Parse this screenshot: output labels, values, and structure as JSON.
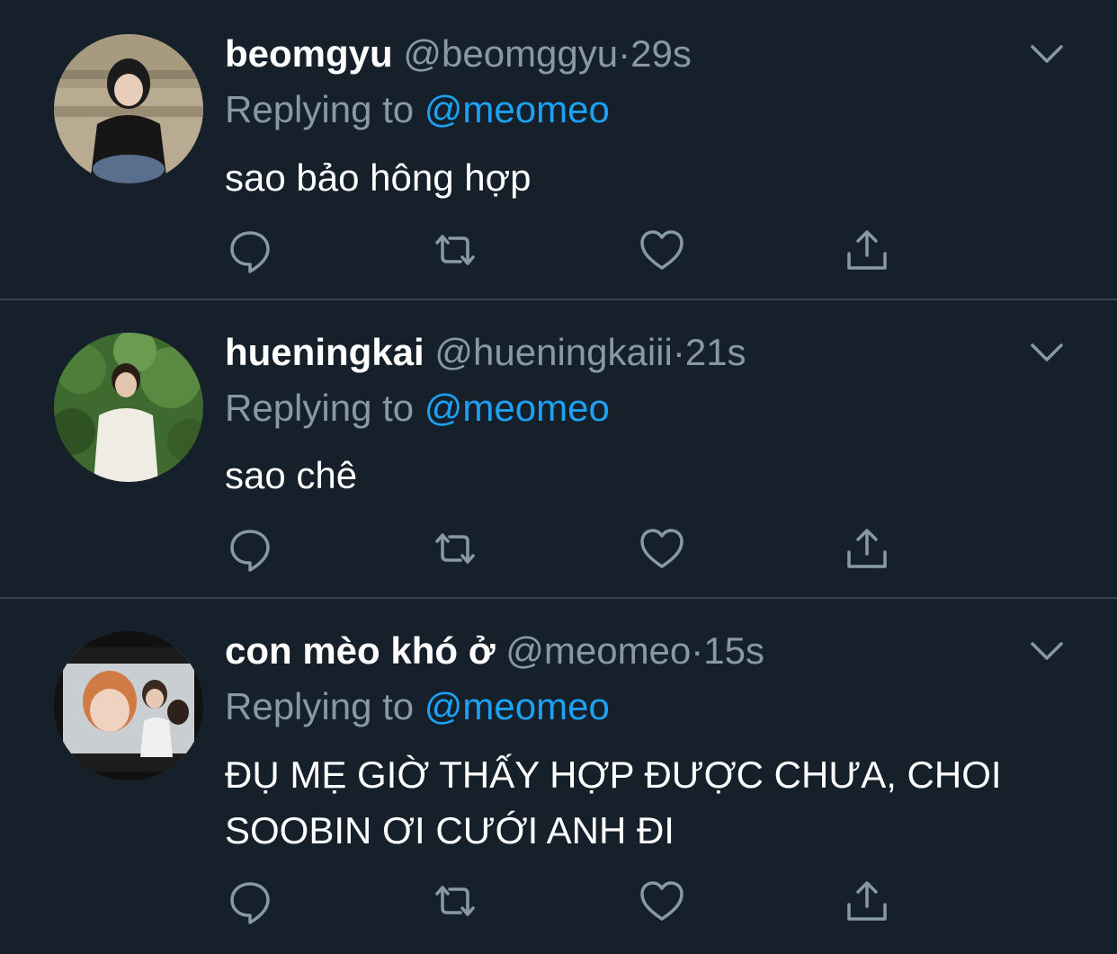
{
  "colors": {
    "background": "#15202b",
    "divider": "#38444d",
    "muted": "#8899a6",
    "mention": "#1da1f2",
    "text": "#ffffff"
  },
  "tweets": [
    {
      "name": "beomgyu",
      "handle": "@beomggyu",
      "dot": "·",
      "time": "29s",
      "replying_label": "Replying to",
      "replying_to": "@meomeo",
      "text": "sao bảo hông hợp",
      "avatar_icon": "person-avatar"
    },
    {
      "name": "hueningkai",
      "handle": "@hueningkaiii",
      "dot": "·",
      "time": "21s",
      "replying_label": "Replying to",
      "replying_to": "@meomeo",
      "text": "sao chê",
      "avatar_icon": "person-avatar"
    },
    {
      "name": "con mèo khó ở",
      "handle": "@meomeo",
      "dot": "·",
      "time": "15s",
      "replying_label": "Replying to",
      "replying_to": "@meomeo",
      "text": "ĐỤ MẸ GIỜ THẤY HỢP ĐƯỢC CHƯA, CHOI SOOBIN ƠI CƯỚI ANH ĐI",
      "avatar_icon": "person-avatar"
    }
  ],
  "action_icons": [
    "reply-icon",
    "retweet-icon",
    "like-icon",
    "share-icon"
  ]
}
